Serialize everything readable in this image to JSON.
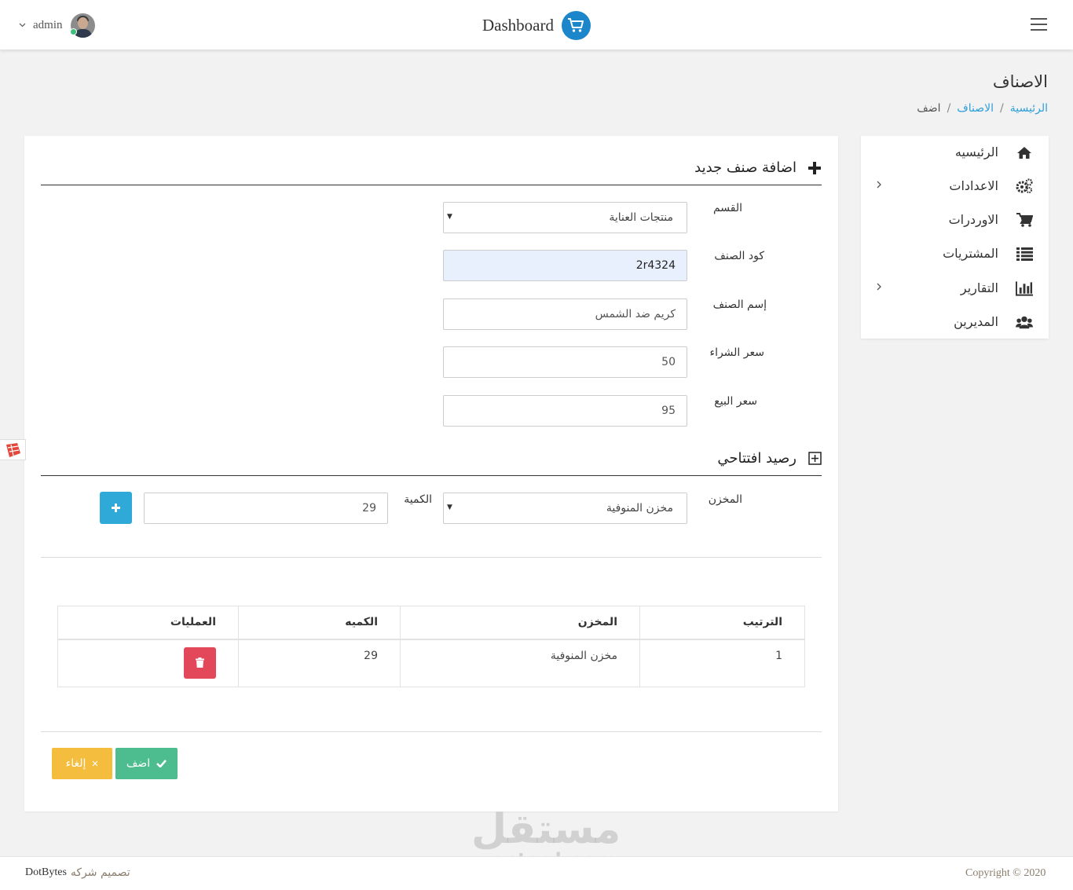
{
  "header": {
    "brand_title": "Dashboard",
    "user_name": "admin",
    "icons": [
      "cart-logo-icon",
      "menu-icon",
      "chevron-down-icon",
      "avatar"
    ]
  },
  "page": {
    "title": "الاصناف",
    "breadcrumb": [
      "الرئيسية",
      "الاصناف",
      "اضف"
    ]
  },
  "sidebar": {
    "items": [
      {
        "label": "الرئيسيه",
        "icon": "home-icon",
        "has_submenu": false
      },
      {
        "label": "الاعدادات",
        "icon": "gears-icon",
        "has_submenu": true
      },
      {
        "label": "الاوردرات",
        "icon": "cart-icon",
        "has_submenu": false
      },
      {
        "label": "المشتريات",
        "icon": "list-icon",
        "has_submenu": false
      },
      {
        "label": "التقارير",
        "icon": "bar-chart-icon",
        "has_submenu": true
      },
      {
        "label": "المديرين",
        "icon": "users-icon",
        "has_submenu": false
      }
    ]
  },
  "form": {
    "section_title": "اضافة صنف جديد",
    "category": {
      "label": "القسم",
      "value": "منتجات العناية"
    },
    "code": {
      "label": "كود الصنف",
      "value": "2r4324"
    },
    "name": {
      "label": "إسم الصنف",
      "value": "كريم ضد الشمس"
    },
    "purchase_price": {
      "label": "سعر الشراء",
      "value": "50"
    },
    "sale_price": {
      "label": "سعر البيع",
      "value": "95"
    }
  },
  "opening_balance": {
    "section_title": "رصيد افتتاحي",
    "store": {
      "label": "المخزن",
      "value": "مخزن المنوفية"
    },
    "quantity": {
      "label": "الكمية",
      "value": "29"
    },
    "table": {
      "headers": [
        "الترتيب",
        "المخزن",
        "الكميه",
        "العمليات"
      ],
      "rows": [
        {
          "index": "1",
          "store": "مخزن المنوفية",
          "quantity": "29"
        }
      ]
    }
  },
  "actions": {
    "save_label": "اضف",
    "cancel_label": "إلغاء"
  },
  "footer": {
    "copyright": "Copyright © 2020",
    "design_text": "تصميم شركه",
    "company": "DotBytes"
  },
  "watermark": {
    "arabic": "مستقل",
    "latin": "mostaql.com"
  },
  "colors": {
    "accent": "#2d9fd8",
    "save": "#4dbd8f",
    "cancel": "#f4bd3e",
    "delete": "#e2475a",
    "add": "#2fa9d8"
  }
}
